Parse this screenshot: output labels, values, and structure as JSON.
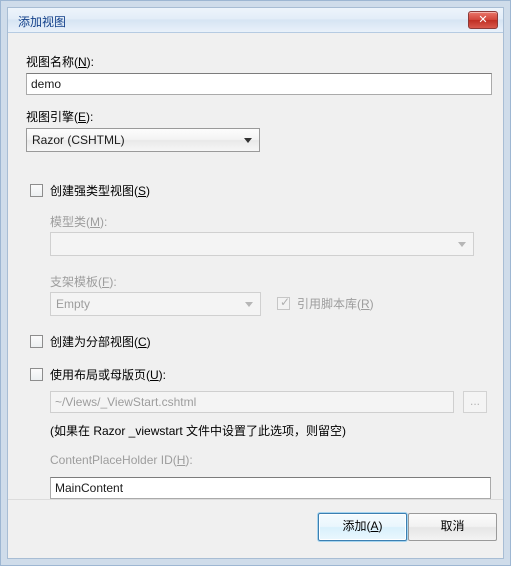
{
  "window": {
    "title": "添加视图",
    "close_label": "✕"
  },
  "form": {
    "view_name_label_pre": "视图名称(",
    "view_name_label_key": "N",
    "view_name_label_post": "):",
    "view_name_value": "demo",
    "view_engine_label_pre": "视图引擎(",
    "view_engine_label_key": "E",
    "view_engine_label_post": "):",
    "view_engine_value": "Razor (CSHTML)",
    "strongly_typed_pre": "创建强类型视图(",
    "strongly_typed_key": "S",
    "strongly_typed_post": ")",
    "strongly_typed_checked": false,
    "model_class_label_pre": "模型类(",
    "model_class_label_key": "M",
    "model_class_label_post": "):",
    "model_class_value": "",
    "scaffold_label_pre": "支架模板(",
    "scaffold_label_key": "F",
    "scaffold_label_post": "):",
    "scaffold_value": "Empty",
    "script_libs_pre": "引用脚本库(",
    "script_libs_key": "R",
    "script_libs_post": ")",
    "script_libs_checked": true,
    "script_libs_tick": "✓",
    "partial_view_pre": "创建为分部视图(",
    "partial_view_key": "C",
    "partial_view_post": ")",
    "partial_view_checked": false,
    "use_layout_pre": "使用布局或母版页(",
    "use_layout_key": "U",
    "use_layout_post": "):",
    "use_layout_checked": false,
    "layout_path_value": "~/Views/_ViewStart.cshtml",
    "browse_label": "...",
    "layout_hint": "(如果在 Razor _viewstart 文件中设置了此选项，则留空)",
    "placeholder_label_pre": "ContentPlaceHolder ID(",
    "placeholder_label_key": "H",
    "placeholder_label_post": "):",
    "placeholder_value": "MainContent"
  },
  "footer": {
    "add_pre": "添加(",
    "add_key": "A",
    "add_post": ")",
    "cancel_label": "取消"
  },
  "colors": {
    "frame": "#cfdcea",
    "titlebar_text": "#15428b",
    "close_red": "#bf2e23",
    "default_button_border": "#3c7fb1",
    "dialog_bg": "#f0f0f0"
  }
}
